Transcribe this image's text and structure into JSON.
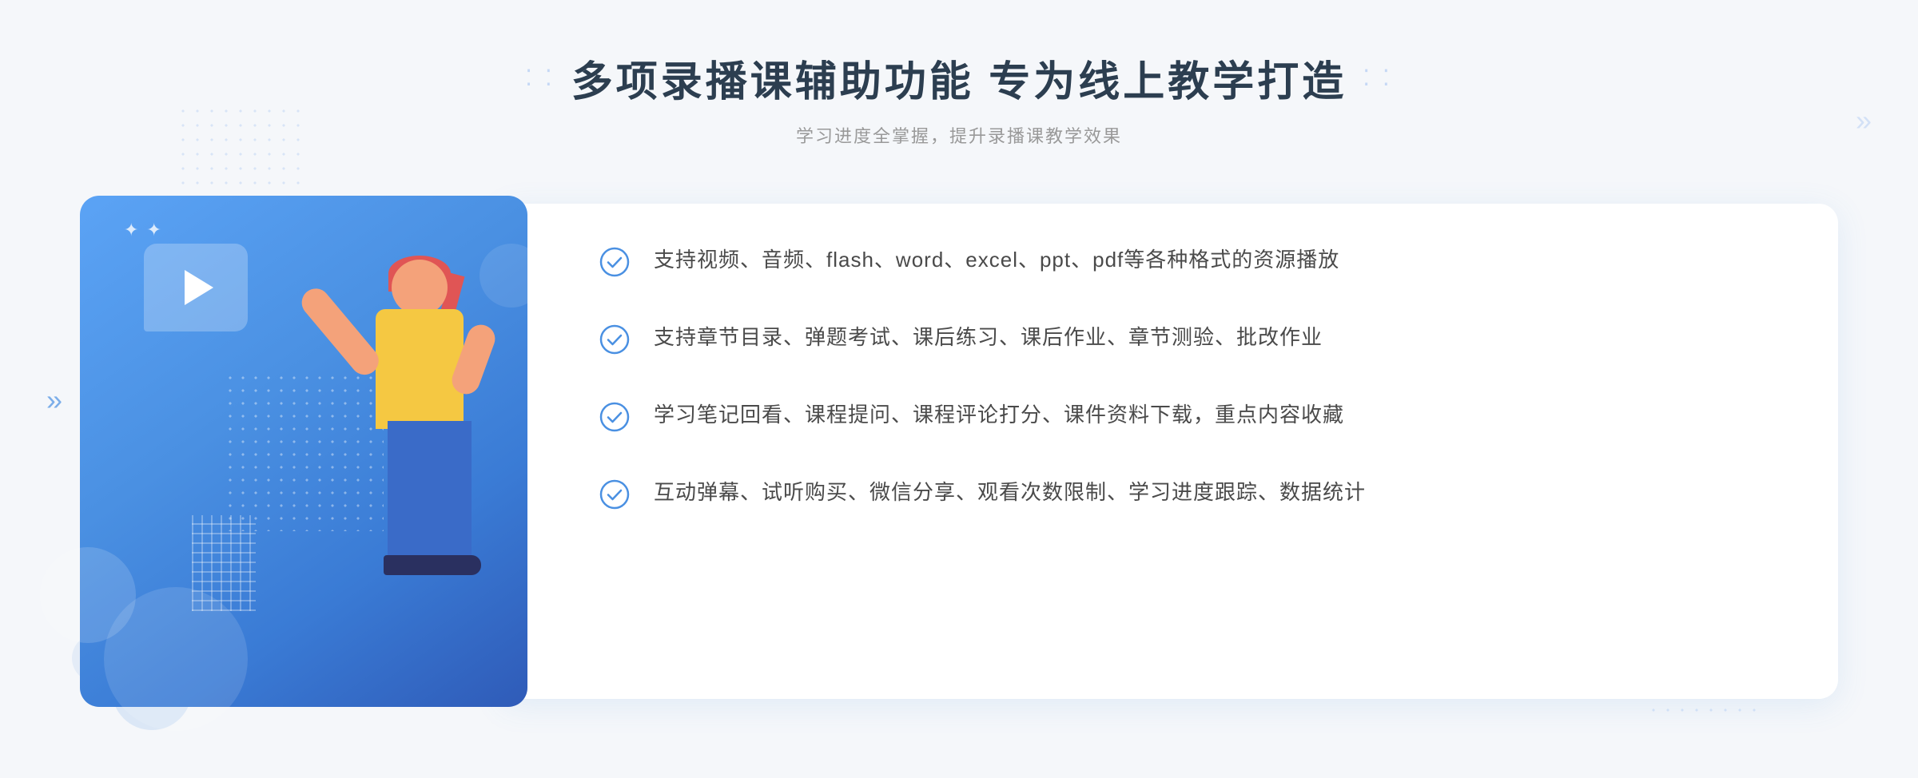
{
  "header": {
    "title": "多项录播课辅助功能 专为线上教学打造",
    "subtitle": "学习进度全掌握，提升录播课教学效果",
    "title_dots_left": "⁚ ⁚",
    "title_dots_right": "⁚ ⁚"
  },
  "features": [
    {
      "id": 1,
      "text": "支持视频、音频、flash、word、excel、ppt、pdf等各种格式的资源播放"
    },
    {
      "id": 2,
      "text": "支持章节目录、弹题考试、课后练习、课后作业、章节测验、批改作业"
    },
    {
      "id": 3,
      "text": "学习笔记回看、课程提问、课程评论打分、课件资料下载，重点内容收藏"
    },
    {
      "id": 4,
      "text": "互动弹幕、试听购买、微信分享、观看次数限制、学习进度跟踪、数据统计"
    }
  ],
  "decorative": {
    "chevron_left": "»",
    "chevron_right": "»"
  }
}
